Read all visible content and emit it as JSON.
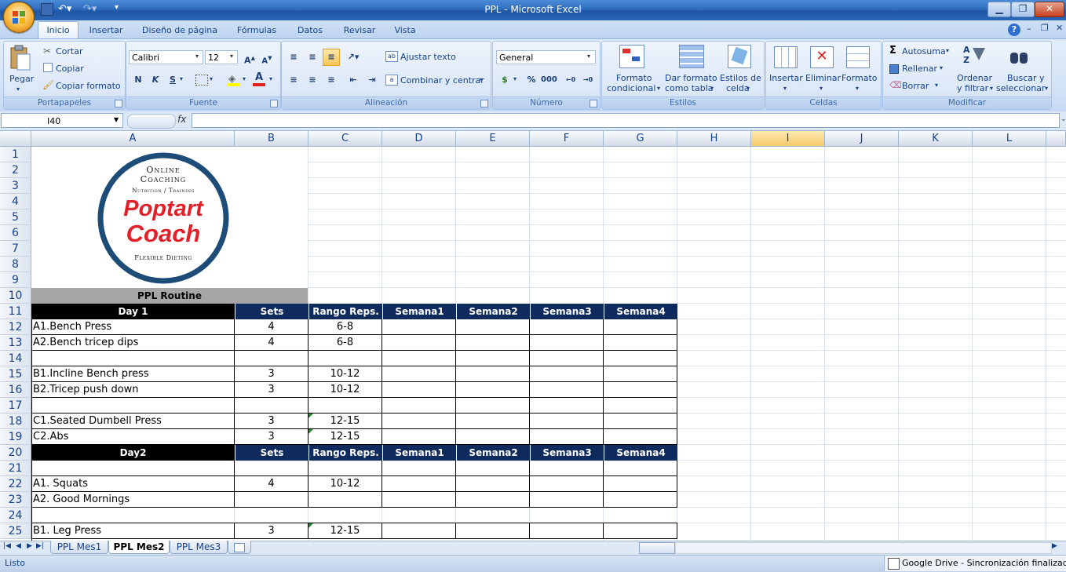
{
  "window": {
    "title": "PPL - Microsoft Excel"
  },
  "tabs": [
    "Inicio",
    "Insertar",
    "Diseño de página",
    "Fórmulas",
    "Datos",
    "Revisar",
    "Vista"
  ],
  "ribbon": {
    "clipboard": {
      "paste": "Pegar",
      "cut": "Cortar",
      "copy": "Copiar",
      "format_painter": "Copiar formato",
      "title": "Portapapeles"
    },
    "font": {
      "name": "Calibri",
      "size": "12",
      "bold": "N",
      "italic": "K",
      "underline": "S",
      "color_letter": "A",
      "title": "Fuente"
    },
    "alignment": {
      "wrap": "Ajustar texto",
      "merge": "Combinar y centrar",
      "title": "Alineación"
    },
    "number": {
      "format": "General",
      "percent": "%",
      "thousands": "000",
      "title": "Número"
    },
    "styles": {
      "conditional1": "Formato",
      "conditional2": "condicional",
      "table1": "Dar formato",
      "table2": "como tabla",
      "cell1": "Estilos de",
      "cell2": "celda",
      "title": "Estilos"
    },
    "cells": {
      "insert": "Insertar",
      "delete": "Eliminar",
      "format": "Formato",
      "title": "Celdas"
    },
    "editing": {
      "autosum": "Autosuma",
      "fill": "Rellenar",
      "clear": "Borrar",
      "sort1": "Ordenar",
      "sort2": "y filtrar",
      "find1": "Buscar y",
      "find2": "seleccionar",
      "title": "Modificar"
    }
  },
  "formula_bar": {
    "name_box": "I40",
    "fx": "fx",
    "value": ""
  },
  "columns": [
    "A",
    "B",
    "C",
    "D",
    "E",
    "F",
    "G",
    "H",
    "I",
    "J",
    "K",
    "L"
  ],
  "selected_column": "I",
  "rows": [
    "1",
    "2",
    "3",
    "4",
    "5",
    "6",
    "7",
    "8",
    "9",
    "10",
    "11",
    "12",
    "13",
    "14",
    "15",
    "16",
    "17",
    "18",
    "19",
    "20",
    "21",
    "22",
    "23",
    "24",
    "25"
  ],
  "logo": {
    "line1": "Online",
    "line2": "Coaching",
    "line3": "Nutrition / Training",
    "brand1": "Poptart",
    "brand2": "Coach",
    "line4": "Flexible Dieting"
  },
  "sheet": {
    "routine_title": "PPL Routine",
    "header_day1": [
      "Day 1",
      "Sets",
      "Rango Reps.",
      "Semana1",
      "Semana2",
      "Semana3",
      "Semana4"
    ],
    "header_day2": [
      "Day2",
      "Sets",
      "Rango Reps.",
      "Semana1",
      "Semana2",
      "Semana3",
      "Semana4"
    ],
    "r12": [
      "A1.Bench Press",
      "4",
      "6-8"
    ],
    "r13": [
      "A2.Bench tricep dips",
      "4",
      "6-8"
    ],
    "r15": [
      "B1.Incline Bench press",
      "3",
      "10-12"
    ],
    "r16": [
      "B2.Tricep push down",
      "3",
      "10-12"
    ],
    "r18": [
      "C1.Seated Dumbell Press",
      "3",
      "12-15"
    ],
    "r19": [
      "C2.Abs",
      "3",
      "12-15"
    ],
    "r22": [
      "A1. Squats",
      "4",
      "10-12"
    ],
    "r23": [
      "A2. Good Mornings",
      "",
      ""
    ],
    "r25": [
      "B1. Leg Press",
      "3",
      "12-15"
    ]
  },
  "sheet_tabs": [
    "PPL Mes1",
    "PPL Mes2",
    "PPL Mes3"
  ],
  "active_sheet": "PPL Mes2",
  "status": {
    "ready": "Listo",
    "tray": "Google Drive - Sincronización finalizada"
  }
}
